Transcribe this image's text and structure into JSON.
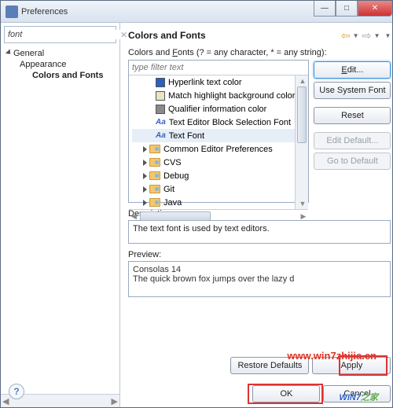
{
  "window": {
    "title": "Preferences"
  },
  "filter": {
    "value": "font"
  },
  "nav": {
    "items": [
      {
        "label": "General"
      },
      {
        "label": "Appearance"
      },
      {
        "label": "Colors and Fonts"
      }
    ]
  },
  "page": {
    "title": "Colors and Fonts",
    "subhead_prefix": "Colors and ",
    "subhead_u": "F",
    "subhead_rest": "onts (? = any character, * = any string):",
    "filter_placeholder": "type filter text",
    "items": [
      {
        "kind": "color",
        "swatch": "blue",
        "label": "Hyperlink text color"
      },
      {
        "kind": "color",
        "swatch": "pale",
        "label": "Match highlight background color"
      },
      {
        "kind": "color",
        "swatch": "gray",
        "label": "Qualifier information color"
      },
      {
        "kind": "font",
        "label": "Text Editor Block Selection Font"
      },
      {
        "kind": "font",
        "label": "Text Font",
        "selected": true
      }
    ],
    "folders": [
      "Common Editor Preferences",
      "CVS",
      "Debug",
      "Git",
      "Java"
    ],
    "buttons": {
      "edit": "Edit...",
      "use_system": "Use System Font",
      "reset": "Reset",
      "edit_default": "Edit Default...",
      "go_default": "Go to Default"
    },
    "desc_label": "Description:",
    "description": "The text font is used by text editors.",
    "preview_label": "Preview:",
    "preview_line1": "Consolas 14",
    "preview_line2": "The quick brown fox jumps over the lazy d"
  },
  "footer": {
    "restore": "Restore Defaults",
    "apply": "Apply",
    "ok": "OK",
    "cancel": "Cancel"
  },
  "watermark": {
    "url": "www.win7zhijia.cn",
    "logo": "WIN7"
  }
}
